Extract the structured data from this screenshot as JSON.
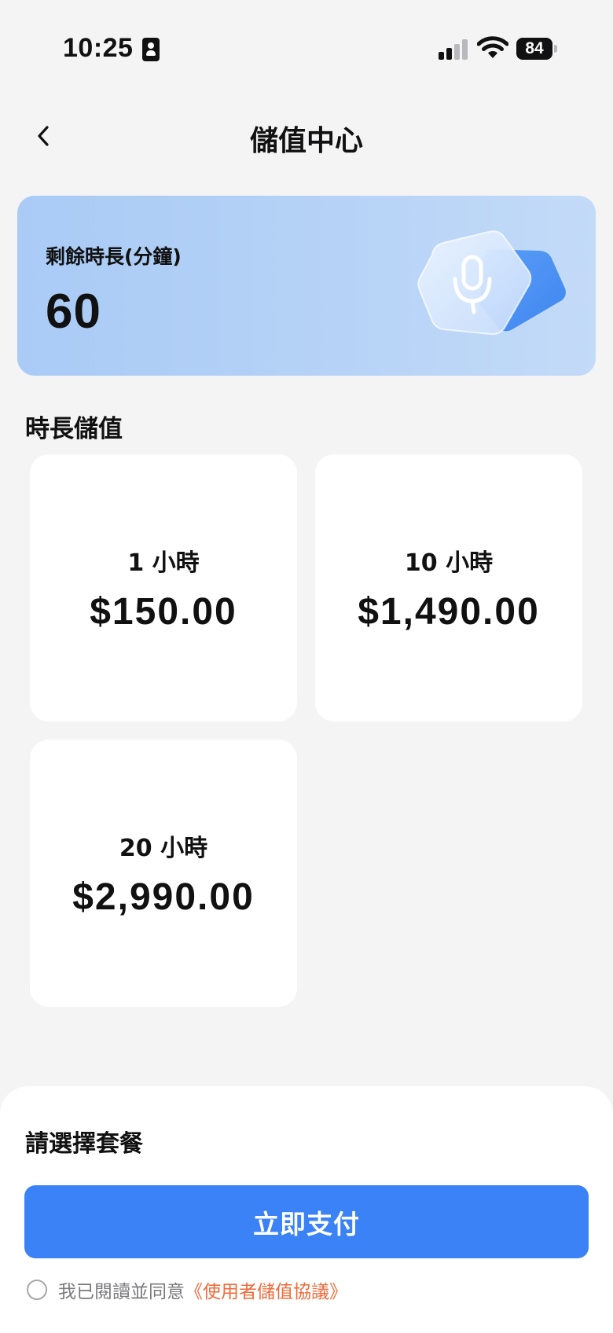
{
  "status_bar": {
    "time": "10:25",
    "battery_level": "84",
    "icons": [
      "contact-card-icon",
      "cellular-signal-icon",
      "wifi-icon",
      "battery-icon"
    ]
  },
  "header": {
    "title": "儲值中心",
    "back_icon": "chevron-left-icon"
  },
  "balance": {
    "label": "剩餘時長(分鐘)",
    "value": "60",
    "icon": "microphone-badge-icon"
  },
  "section_title": "時長儲值",
  "plans": [
    {
      "duration": "1 小時",
      "price": "$150.00"
    },
    {
      "duration": "10 小時",
      "price": "$1,490.00"
    },
    {
      "duration": "20 小時",
      "price": "$2,990.00"
    }
  ],
  "bottom": {
    "prompt": "請選擇套餐",
    "pay_label": "立即支付",
    "agree_text": "我已閱讀並同意",
    "agree_link": "《使用者儲值協議》"
  },
  "colors": {
    "primary": "#3b82f6",
    "link": "#f06a3a",
    "background": "#f4f4f5",
    "card_gradient_start": "#a9cbf6",
    "card_gradient_end": "#c3dbf8"
  }
}
